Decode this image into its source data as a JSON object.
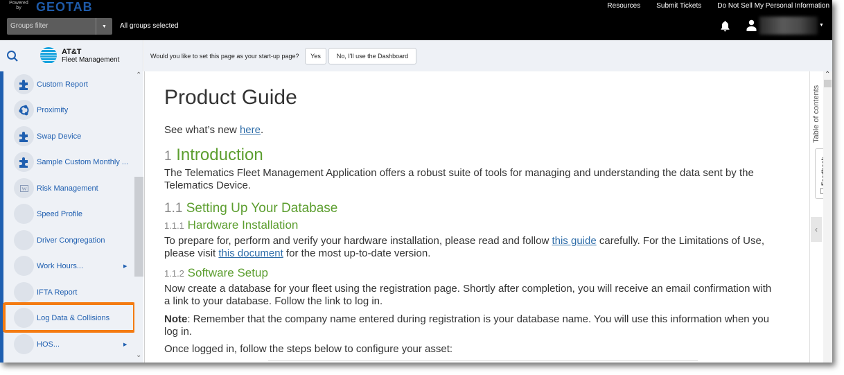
{
  "header": {
    "powered_by": "Powered by",
    "brand": "GEOTAB",
    "groups_filter_placeholder": "Groups filter",
    "groups_status": "All groups selected",
    "links": [
      "Resources",
      "Submit Tickets",
      "Do Not Sell My Personal Information"
    ],
    "icons": {
      "notifications": "bell-icon",
      "user": "user-icon",
      "menu": "caret-down-icon"
    }
  },
  "logo": {
    "brand": "AT&T",
    "product": "Fleet Management"
  },
  "startup_prompt": {
    "question": "Would you like to set this page as your start-up page?",
    "yes_label": "Yes",
    "no_label": "No, I'll use the Dashboard"
  },
  "sidebar": {
    "items": [
      {
        "label": "Custom Report",
        "icon": "puzzle-icon",
        "has_submenu": false
      },
      {
        "label": "Proximity",
        "icon": "proximity-icon",
        "has_submenu": false
      },
      {
        "label": "Swap Device",
        "icon": "puzzle-icon",
        "has_submenu": false
      },
      {
        "label": "Sample Custom Monthly ...",
        "icon": "puzzle-icon",
        "has_submenu": false
      },
      {
        "label": "Risk Management",
        "icon": "risk-icon",
        "has_submenu": false
      },
      {
        "label": "Speed Profile",
        "icon": "blank-icon",
        "has_submenu": false
      },
      {
        "label": "Driver Congregation",
        "icon": "blank-icon",
        "has_submenu": false
      },
      {
        "label": "Work Hours...",
        "icon": "blank-icon",
        "has_submenu": true
      },
      {
        "label": "IFTA Report",
        "icon": "blank-icon",
        "has_submenu": false
      },
      {
        "label": "Log Data & Collisions",
        "icon": "blank-icon",
        "has_submenu": false,
        "highlighted": true
      },
      {
        "label": "HOS...",
        "icon": "blank-icon",
        "has_submenu": true
      }
    ],
    "highlight_color": "#f47b12",
    "accent_color": "#1f5fb0"
  },
  "document": {
    "title": "Product Guide",
    "whats_new_prefix": "See what’s new ",
    "whats_new_link": "here",
    "whats_new_suffix": ".",
    "sections": {
      "intro_num": "1",
      "intro_title": "Introduction",
      "intro_text_1": "The Telematics Fleet Management Application offers a robust suite of tools for managing and understanding the data sent by the",
      "intro_text_2": "Telematics Device.",
      "db_num": "1.1",
      "db_title": "Setting Up Your Database",
      "hw_num": "1.1.1",
      "hw_title": "Hardware Installation",
      "hw_text_1a": "To prepare for, perform and verify your hardware installation, please read and follow ",
      "hw_link_1": "this guide",
      "hw_text_1b": " carefully. For the Limitations of Use,",
      "hw_text_2a": "please visit ",
      "hw_link_2": "this document",
      "hw_text_2b": " for the most up-to-date version.",
      "sw_num": "1.1.2",
      "sw_title": "Software Setup",
      "sw_text_1": "Now create a database for your fleet using the registration page. Shortly after completion, you will receive an email confirmation with",
      "sw_text_2": "a link to your database. Follow the link to log in.",
      "note_label": "Note",
      "note_text_1": ": Remember that the company name entered during registration is your database name. You will use this information when you",
      "note_text_2": "log in.",
      "steps_intro": "Once logged in, follow the steps below to configure your asset:"
    },
    "heading_color": "#5c9e2f",
    "link_color": "#2d6ca8"
  },
  "right_rail": {
    "toc_label": "Table of contents",
    "feedback_label": "Feedback",
    "collapse_icon": "chevron-left-icon"
  }
}
